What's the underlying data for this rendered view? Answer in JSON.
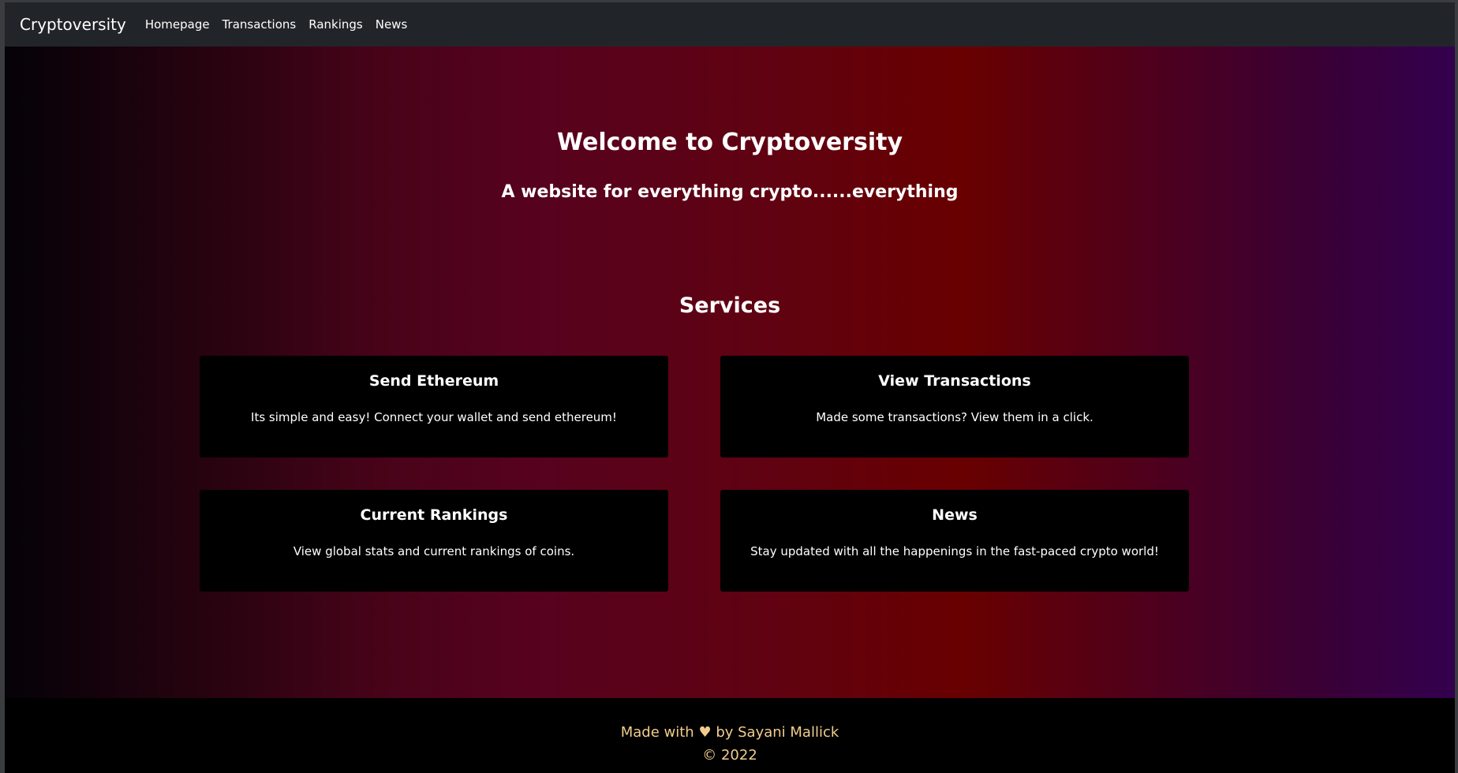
{
  "navbar": {
    "brand": "Cryptoversity",
    "links": [
      "Homepage",
      "Transactions",
      "Rankings",
      "News"
    ]
  },
  "hero": {
    "title": "Welcome to Cryptoversity",
    "subtitle": "A website for everything crypto......everything",
    "services_title": "Services"
  },
  "cards": [
    {
      "title": "Send Ethereum",
      "text": "Its simple and easy! Connect your wallet and send ethereum!"
    },
    {
      "title": "View Transactions",
      "text": "Made some transactions? View them in a click."
    },
    {
      "title": "Current Rankings",
      "text": "View global stats and current rankings of coins."
    },
    {
      "title": "News",
      "text": "Stay updated with all the happenings in the fast-paced crypto world!"
    }
  ],
  "footer": {
    "made_with": "Made with",
    "heart": "♥",
    "by": "by Sayani Mallick",
    "copyright": "© 2022"
  },
  "colors": {
    "navbar_bg": "#212529",
    "card_bg": "#000000",
    "footer_text": "#f0cd8e"
  }
}
